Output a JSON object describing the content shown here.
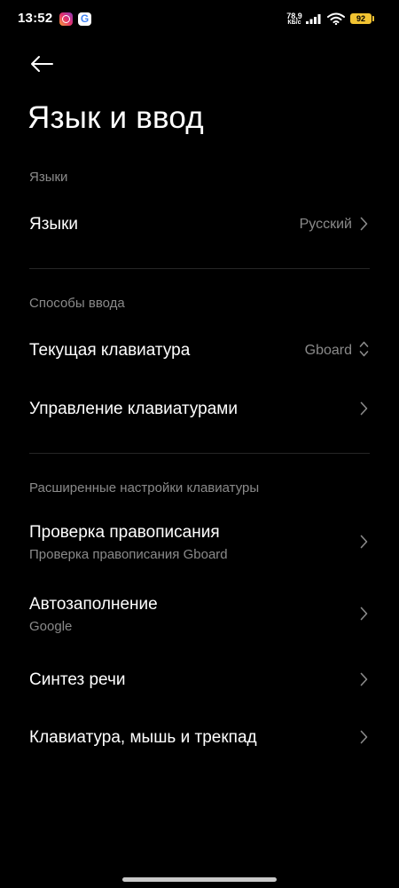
{
  "status_bar": {
    "time": "13:52",
    "net_speed_value": "78,9",
    "net_speed_unit": "КБ/с",
    "battery": "92",
    "icons": [
      "instagram-icon",
      "google-icon",
      "signal-icon",
      "wifi-icon",
      "battery-icon"
    ],
    "google_letter": "G",
    "battery_color": "#f2c332"
  },
  "header": {
    "back_icon": "back-arrow-icon",
    "title": "Язык и ввод"
  },
  "sections": {
    "languages": {
      "header": "Языки",
      "items": [
        {
          "title": "Языки",
          "value": "Русский",
          "icon": "chevron-right-icon"
        }
      ]
    },
    "input_methods": {
      "header": "Способы ввода",
      "items": [
        {
          "title": "Текущая клавиатура",
          "value": "Gboard",
          "icon": "chevron-updown-icon"
        },
        {
          "title": "Управление клавиатурами",
          "icon": "chevron-right-icon"
        }
      ]
    },
    "advanced": {
      "header": "Расширенные настройки клавиатуры",
      "items": [
        {
          "title": "Проверка правописания",
          "subtitle": "Проверка правописания Gboard",
          "icon": "chevron-right-icon"
        },
        {
          "title": "Автозаполнение",
          "subtitle": "Google",
          "icon": "chevron-right-icon"
        },
        {
          "title": "Синтез речи",
          "icon": "chevron-right-icon"
        },
        {
          "title": "Клавиатура, мышь и трекпад",
          "icon": "chevron-right-icon"
        }
      ]
    }
  },
  "colors": {
    "background": "#000000",
    "text_primary": "#ffffff",
    "text_secondary": "#8a8a8a",
    "divider": "#262626"
  }
}
